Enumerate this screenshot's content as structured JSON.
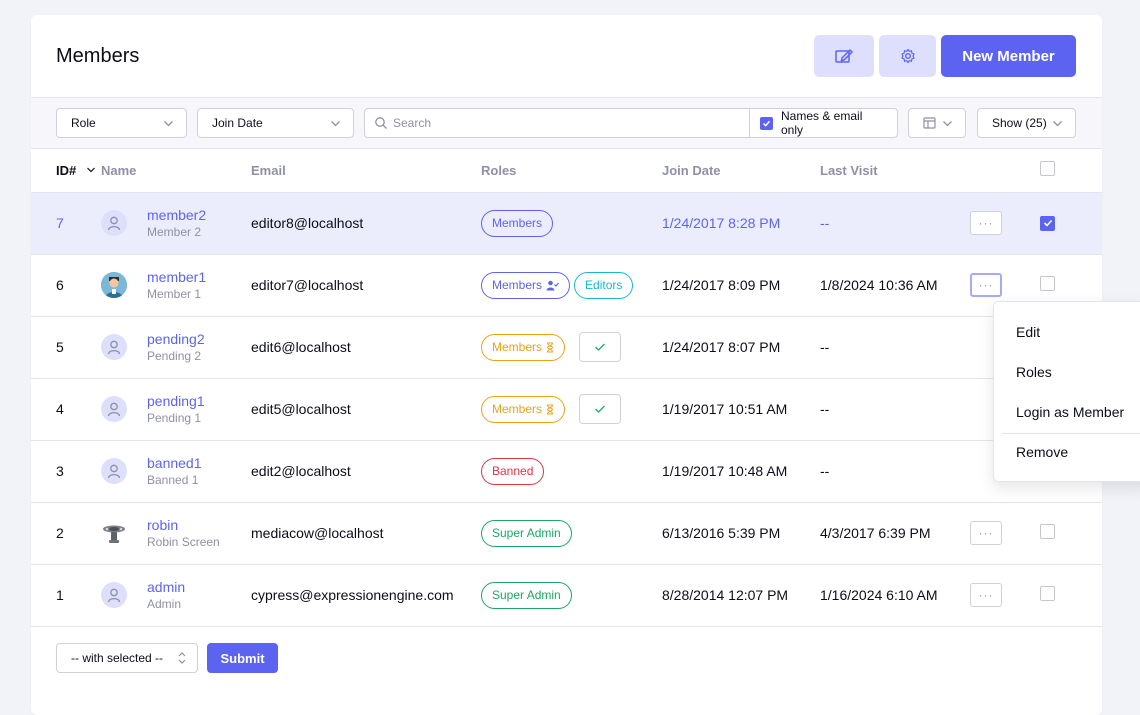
{
  "page": {
    "title": "Members",
    "new_member_label": "New Member"
  },
  "filters": {
    "role_label": "Role",
    "join_date_label": "Join Date",
    "search_placeholder": "Search",
    "names_email_label": "Names & email only",
    "show_label": "Show (25)"
  },
  "table": {
    "headers": {
      "id": "ID#",
      "name": "Name",
      "email": "Email",
      "roles": "Roles",
      "join_date": "Join Date",
      "last_visit": "Last Visit"
    },
    "rows": [
      {
        "id": "7",
        "username": "member2",
        "screen_name": "Member 2",
        "email": "editor8@localhost",
        "roles": [
          "Members"
        ],
        "join_date": "1/24/2017 8:28 PM",
        "last_visit": "--"
      },
      {
        "id": "6",
        "username": "member1",
        "screen_name": "Member 1",
        "email": "editor7@localhost",
        "roles": [
          "Members",
          "Editors"
        ],
        "join_date": "1/24/2017 8:09 PM",
        "last_visit": "1/8/2024 10:36 AM"
      },
      {
        "id": "5",
        "username": "pending2",
        "screen_name": "Pending 2",
        "email": "edit6@localhost",
        "roles": [
          "Members"
        ],
        "join_date": "1/24/2017 8:07 PM",
        "last_visit": "--"
      },
      {
        "id": "4",
        "username": "pending1",
        "screen_name": "Pending 1",
        "email": "edit5@localhost",
        "roles": [
          "Members"
        ],
        "join_date": "1/19/2017 10:51 AM",
        "last_visit": "--"
      },
      {
        "id": "3",
        "username": "banned1",
        "screen_name": "Banned 1",
        "email": "edit2@localhost",
        "roles": [
          "Banned"
        ],
        "join_date": "1/19/2017 10:48 AM",
        "last_visit": "--"
      },
      {
        "id": "2",
        "username": "robin",
        "screen_name": "Robin Screen",
        "email": "mediacow@localhost",
        "roles": [
          "Super Admin"
        ],
        "join_date": "6/13/2016 5:39 PM",
        "last_visit": "4/3/2017 6:39 PM"
      },
      {
        "id": "1",
        "username": "admin",
        "screen_name": "Admin",
        "email": "cypress@expressionengine.com",
        "roles": [
          "Super Admin"
        ],
        "join_date": "8/28/2014 12:07 PM",
        "last_visit": "1/16/2024 6:10 AM"
      }
    ]
  },
  "actions_menu": {
    "items": [
      "Edit",
      "Roles",
      "Login as Member",
      "Remove"
    ]
  },
  "bulk": {
    "with_selected_label": "-- with selected --",
    "submit_label": "Submit"
  },
  "colors": {
    "accent": "#5d63f1",
    "editors": "#1ab8cf",
    "pending": "#e9a217",
    "banned": "#e13444",
    "super_admin": "#1ea665"
  },
  "icons": {
    "edit_header": "edit-icon",
    "settings_header": "gear-icon",
    "search": "search-icon",
    "columns": "columns-icon",
    "approve": "check-icon",
    "pending_role": "hourglass-icon",
    "primary_role": "user-check-icon"
  }
}
